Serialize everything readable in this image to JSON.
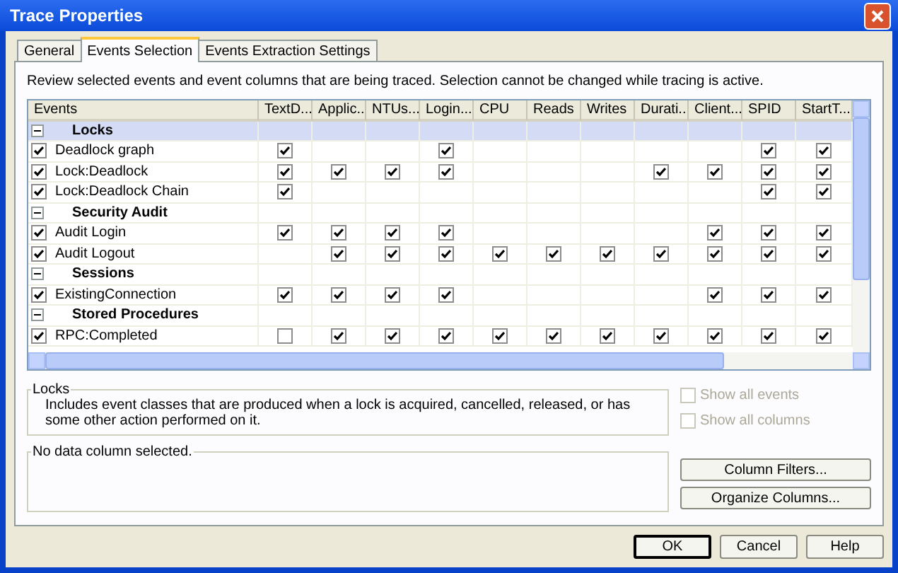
{
  "window": {
    "title": "Trace Properties"
  },
  "tabs": [
    {
      "label": "General",
      "selected": false
    },
    {
      "label": "Events Selection",
      "selected": true
    },
    {
      "label": "Events Extraction Settings",
      "selected": false
    }
  ],
  "description": "Review selected events and event columns that are being traced. Selection cannot be changed while tracing is active.",
  "grid": {
    "columns": [
      "Events",
      "TextD...",
      "Applic...",
      "NTUs...",
      "Login...",
      "CPU",
      "Reads",
      "Writes",
      "Durati...",
      "Client...",
      "SPID",
      "StartT..."
    ],
    "rows": [
      {
        "kind": "category",
        "label": "Locks",
        "expanded": true,
        "selected": true
      },
      {
        "kind": "event",
        "label": "Deadlock graph",
        "checked": true,
        "selected": false,
        "cells": [
          {
            "kind": "check",
            "checked": true
          },
          {
            "kind": "none"
          },
          {
            "kind": "none"
          },
          {
            "kind": "check",
            "checked": true
          },
          {
            "kind": "none"
          },
          {
            "kind": "none"
          },
          {
            "kind": "none"
          },
          {
            "kind": "none"
          },
          {
            "kind": "none"
          },
          {
            "kind": "check",
            "checked": true
          },
          {
            "kind": "check",
            "checked": true
          }
        ]
      },
      {
        "kind": "event",
        "label": "Lock:Deadlock",
        "checked": true,
        "selected": false,
        "cells": [
          {
            "kind": "check",
            "checked": true
          },
          {
            "kind": "check",
            "checked": true
          },
          {
            "kind": "check",
            "checked": true
          },
          {
            "kind": "check",
            "checked": true
          },
          {
            "kind": "none"
          },
          {
            "kind": "none"
          },
          {
            "kind": "none"
          },
          {
            "kind": "check",
            "checked": true
          },
          {
            "kind": "check",
            "checked": true
          },
          {
            "kind": "check",
            "checked": true
          },
          {
            "kind": "check",
            "checked": true
          }
        ]
      },
      {
        "kind": "event",
        "label": "Lock:Deadlock Chain",
        "checked": true,
        "selected": false,
        "cells": [
          {
            "kind": "check",
            "checked": true
          },
          {
            "kind": "none"
          },
          {
            "kind": "none"
          },
          {
            "kind": "none"
          },
          {
            "kind": "none"
          },
          {
            "kind": "none"
          },
          {
            "kind": "none"
          },
          {
            "kind": "none"
          },
          {
            "kind": "none"
          },
          {
            "kind": "check",
            "checked": true
          },
          {
            "kind": "check",
            "checked": true
          }
        ]
      },
      {
        "kind": "category",
        "label": "Security Audit",
        "expanded": true,
        "selected": false
      },
      {
        "kind": "event",
        "label": "Audit Login",
        "checked": true,
        "selected": false,
        "cells": [
          {
            "kind": "check",
            "checked": true
          },
          {
            "kind": "check",
            "checked": true
          },
          {
            "kind": "check",
            "checked": true
          },
          {
            "kind": "check",
            "checked": true
          },
          {
            "kind": "none"
          },
          {
            "kind": "none"
          },
          {
            "kind": "none"
          },
          {
            "kind": "none"
          },
          {
            "kind": "check",
            "checked": true
          },
          {
            "kind": "check",
            "checked": true
          },
          {
            "kind": "check",
            "checked": true
          }
        ]
      },
      {
        "kind": "event",
        "label": "Audit Logout",
        "checked": true,
        "selected": false,
        "cells": [
          {
            "kind": "none"
          },
          {
            "kind": "check",
            "checked": true
          },
          {
            "kind": "check",
            "checked": true
          },
          {
            "kind": "check",
            "checked": true
          },
          {
            "kind": "check",
            "checked": true
          },
          {
            "kind": "check",
            "checked": true
          },
          {
            "kind": "check",
            "checked": true
          },
          {
            "kind": "check",
            "checked": true
          },
          {
            "kind": "check",
            "checked": true
          },
          {
            "kind": "check",
            "checked": true
          },
          {
            "kind": "check",
            "checked": true
          }
        ]
      },
      {
        "kind": "category",
        "label": "Sessions",
        "expanded": true,
        "selected": false
      },
      {
        "kind": "event",
        "label": "ExistingConnection",
        "checked": true,
        "selected": false,
        "cells": [
          {
            "kind": "check",
            "checked": true
          },
          {
            "kind": "check",
            "checked": true
          },
          {
            "kind": "check",
            "checked": true
          },
          {
            "kind": "check",
            "checked": true
          },
          {
            "kind": "none"
          },
          {
            "kind": "none"
          },
          {
            "kind": "none"
          },
          {
            "kind": "none"
          },
          {
            "kind": "check",
            "checked": true
          },
          {
            "kind": "check",
            "checked": true
          },
          {
            "kind": "check",
            "checked": true
          }
        ]
      },
      {
        "kind": "category",
        "label": "Stored Procedures",
        "expanded": true,
        "selected": false
      },
      {
        "kind": "event",
        "label": "RPC:Completed",
        "checked": true,
        "selected": false,
        "cells": [
          {
            "kind": "check",
            "checked": false
          },
          {
            "kind": "check",
            "checked": true
          },
          {
            "kind": "check",
            "checked": true
          },
          {
            "kind": "check",
            "checked": true
          },
          {
            "kind": "check",
            "checked": true
          },
          {
            "kind": "check",
            "checked": true
          },
          {
            "kind": "check",
            "checked": true
          },
          {
            "kind": "check",
            "checked": true
          },
          {
            "kind": "check",
            "checked": true
          },
          {
            "kind": "check",
            "checked": true
          },
          {
            "kind": "check",
            "checked": true
          }
        ]
      }
    ]
  },
  "event_group": {
    "title": "Locks",
    "text": "Includes event classes that are produced when a lock is acquired, cancelled, released, or has some other action performed on it."
  },
  "options": [
    {
      "label": "Show all events",
      "checked": false,
      "disabled": true
    },
    {
      "label": "Show all columns",
      "checked": false,
      "disabled": true
    }
  ],
  "column_group": {
    "title": "No data column selected."
  },
  "side_buttons": [
    "Column Filters...",
    "Organize Columns..."
  ],
  "buttons": [
    {
      "label": "OK",
      "default": true
    },
    {
      "label": "Cancel",
      "default": false
    },
    {
      "label": "Help",
      "default": false
    }
  ]
}
